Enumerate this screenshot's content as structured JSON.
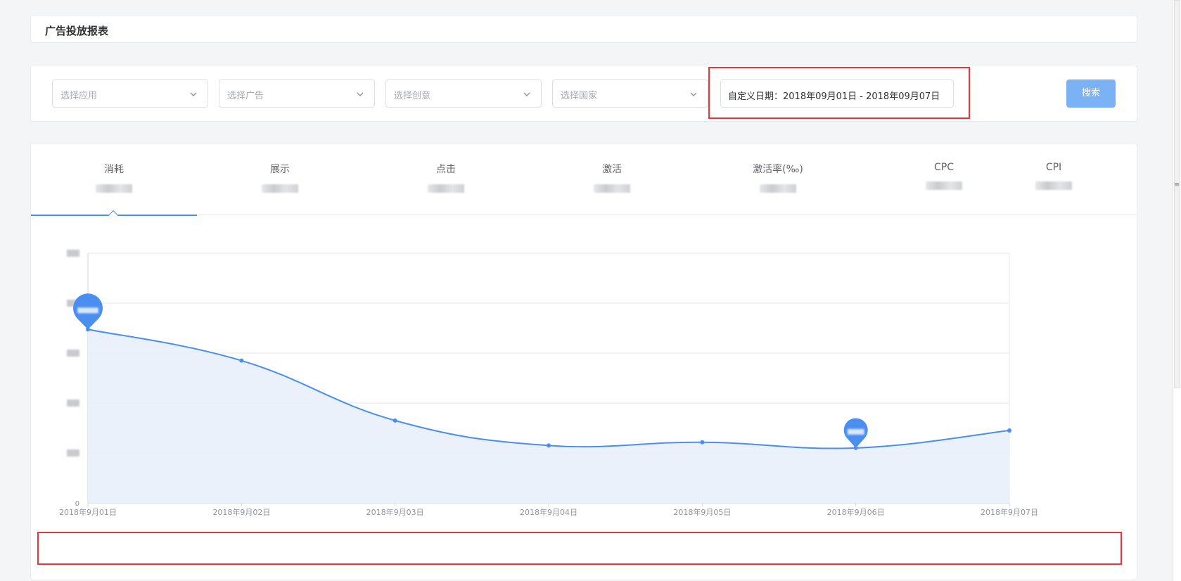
{
  "page": {
    "title": "广告投放报表"
  },
  "filters": {
    "app_placeholder": "选择应用",
    "ad_placeholder": "选择广告",
    "creative_placeholder": "选择创意",
    "country_placeholder": "选择国家",
    "date_range": "自定义日期：2018年09月01日 - 2018年09月07日",
    "search_label": "搜索"
  },
  "tabs": [
    {
      "label": "消耗",
      "active": true
    },
    {
      "label": "展示",
      "active": false
    },
    {
      "label": "点击",
      "active": false
    },
    {
      "label": "激活",
      "active": false
    },
    {
      "label": "激活率(‰)",
      "active": false
    },
    {
      "label": "CPC",
      "active": false
    },
    {
      "label": "CPI",
      "active": false
    }
  ],
  "colors": {
    "accent": "#4a8ff0",
    "area_fill": "#e8effb",
    "highlight": "#e8373a",
    "search_button": "#7bb2f5"
  },
  "chart_data": {
    "type": "area",
    "categories": [
      "2018年9月01日",
      "2018年9月02日",
      "2018年9月03日",
      "2018年9月04日",
      "2018年9月05日",
      "2018年9月06日",
      "2018年9月07日"
    ],
    "y_tick_first_label": "0",
    "series": [
      {
        "values": [
          0.695,
          0.57,
          0.33,
          0.23,
          0.243,
          0.22,
          0.29
        ]
      }
    ],
    "ylim": [
      0,
      1
    ],
    "grid": true,
    "markers": {
      "max_index": 0,
      "min_index": 5
    }
  }
}
